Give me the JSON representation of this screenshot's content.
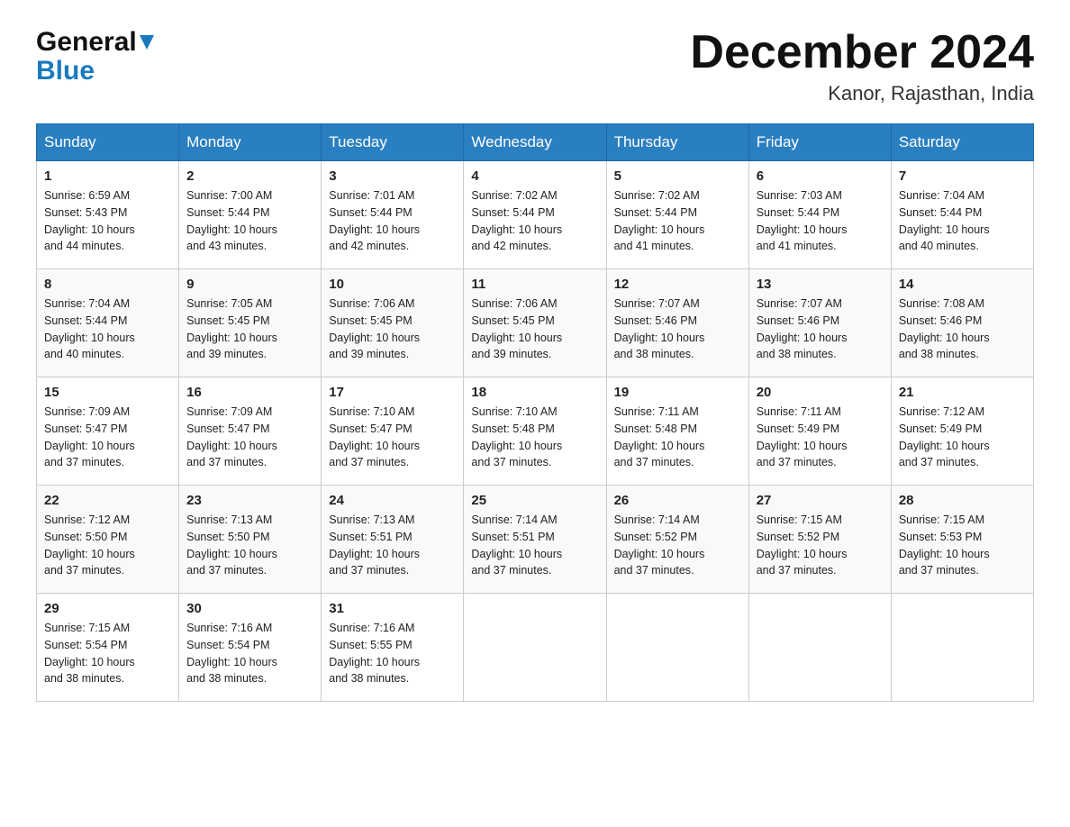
{
  "logo": {
    "general": "General",
    "blue": "Blue",
    "triangle": "▲"
  },
  "title": "December 2024",
  "location": "Kanor, Rajasthan, India",
  "days_of_week": [
    "Sunday",
    "Monday",
    "Tuesday",
    "Wednesday",
    "Thursday",
    "Friday",
    "Saturday"
  ],
  "weeks": [
    [
      {
        "day": "1",
        "sunrise": "6:59 AM",
        "sunset": "5:43 PM",
        "daylight": "10 hours and 44 minutes."
      },
      {
        "day": "2",
        "sunrise": "7:00 AM",
        "sunset": "5:44 PM",
        "daylight": "10 hours and 43 minutes."
      },
      {
        "day": "3",
        "sunrise": "7:01 AM",
        "sunset": "5:44 PM",
        "daylight": "10 hours and 42 minutes."
      },
      {
        "day": "4",
        "sunrise": "7:02 AM",
        "sunset": "5:44 PM",
        "daylight": "10 hours and 42 minutes."
      },
      {
        "day": "5",
        "sunrise": "7:02 AM",
        "sunset": "5:44 PM",
        "daylight": "10 hours and 41 minutes."
      },
      {
        "day": "6",
        "sunrise": "7:03 AM",
        "sunset": "5:44 PM",
        "daylight": "10 hours and 41 minutes."
      },
      {
        "day": "7",
        "sunrise": "7:04 AM",
        "sunset": "5:44 PM",
        "daylight": "10 hours and 40 minutes."
      }
    ],
    [
      {
        "day": "8",
        "sunrise": "7:04 AM",
        "sunset": "5:44 PM",
        "daylight": "10 hours and 40 minutes."
      },
      {
        "day": "9",
        "sunrise": "7:05 AM",
        "sunset": "5:45 PM",
        "daylight": "10 hours and 39 minutes."
      },
      {
        "day": "10",
        "sunrise": "7:06 AM",
        "sunset": "5:45 PM",
        "daylight": "10 hours and 39 minutes."
      },
      {
        "day": "11",
        "sunrise": "7:06 AM",
        "sunset": "5:45 PM",
        "daylight": "10 hours and 39 minutes."
      },
      {
        "day": "12",
        "sunrise": "7:07 AM",
        "sunset": "5:46 PM",
        "daylight": "10 hours and 38 minutes."
      },
      {
        "day": "13",
        "sunrise": "7:07 AM",
        "sunset": "5:46 PM",
        "daylight": "10 hours and 38 minutes."
      },
      {
        "day": "14",
        "sunrise": "7:08 AM",
        "sunset": "5:46 PM",
        "daylight": "10 hours and 38 minutes."
      }
    ],
    [
      {
        "day": "15",
        "sunrise": "7:09 AM",
        "sunset": "5:47 PM",
        "daylight": "10 hours and 37 minutes."
      },
      {
        "day": "16",
        "sunrise": "7:09 AM",
        "sunset": "5:47 PM",
        "daylight": "10 hours and 37 minutes."
      },
      {
        "day": "17",
        "sunrise": "7:10 AM",
        "sunset": "5:47 PM",
        "daylight": "10 hours and 37 minutes."
      },
      {
        "day": "18",
        "sunrise": "7:10 AM",
        "sunset": "5:48 PM",
        "daylight": "10 hours and 37 minutes."
      },
      {
        "day": "19",
        "sunrise": "7:11 AM",
        "sunset": "5:48 PM",
        "daylight": "10 hours and 37 minutes."
      },
      {
        "day": "20",
        "sunrise": "7:11 AM",
        "sunset": "5:49 PM",
        "daylight": "10 hours and 37 minutes."
      },
      {
        "day": "21",
        "sunrise": "7:12 AM",
        "sunset": "5:49 PM",
        "daylight": "10 hours and 37 minutes."
      }
    ],
    [
      {
        "day": "22",
        "sunrise": "7:12 AM",
        "sunset": "5:50 PM",
        "daylight": "10 hours and 37 minutes."
      },
      {
        "day": "23",
        "sunrise": "7:13 AM",
        "sunset": "5:50 PM",
        "daylight": "10 hours and 37 minutes."
      },
      {
        "day": "24",
        "sunrise": "7:13 AM",
        "sunset": "5:51 PM",
        "daylight": "10 hours and 37 minutes."
      },
      {
        "day": "25",
        "sunrise": "7:14 AM",
        "sunset": "5:51 PM",
        "daylight": "10 hours and 37 minutes."
      },
      {
        "day": "26",
        "sunrise": "7:14 AM",
        "sunset": "5:52 PM",
        "daylight": "10 hours and 37 minutes."
      },
      {
        "day": "27",
        "sunrise": "7:15 AM",
        "sunset": "5:52 PM",
        "daylight": "10 hours and 37 minutes."
      },
      {
        "day": "28",
        "sunrise": "7:15 AM",
        "sunset": "5:53 PM",
        "daylight": "10 hours and 37 minutes."
      }
    ],
    [
      {
        "day": "29",
        "sunrise": "7:15 AM",
        "sunset": "5:54 PM",
        "daylight": "10 hours and 38 minutes."
      },
      {
        "day": "30",
        "sunrise": "7:16 AM",
        "sunset": "5:54 PM",
        "daylight": "10 hours and 38 minutes."
      },
      {
        "day": "31",
        "sunrise": "7:16 AM",
        "sunset": "5:55 PM",
        "daylight": "10 hours and 38 minutes."
      },
      null,
      null,
      null,
      null
    ]
  ],
  "labels": {
    "sunrise": "Sunrise:",
    "sunset": "Sunset:",
    "daylight": "Daylight:"
  }
}
